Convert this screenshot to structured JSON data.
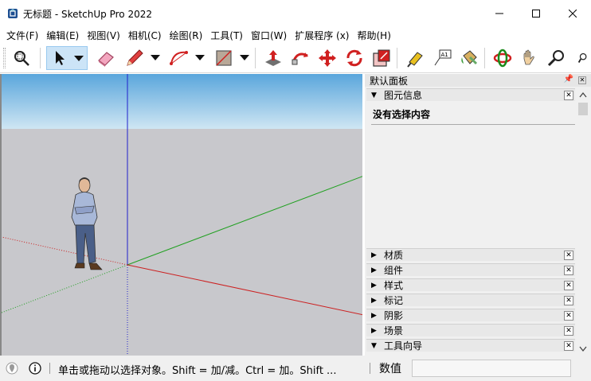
{
  "window": {
    "title": "无标题 - SketchUp Pro 2022",
    "app_icon": "sketchup-logo-icon",
    "controls": [
      "minimize-icon",
      "maximize-icon",
      "close-icon"
    ]
  },
  "menu": [
    {
      "label": "文件(F)"
    },
    {
      "label": "编辑(E)"
    },
    {
      "label": "视图(V)"
    },
    {
      "label": "相机(C)"
    },
    {
      "label": "绘图(R)"
    },
    {
      "label": "工具(T)"
    },
    {
      "label": "窗口(W)"
    },
    {
      "label": "扩展程序 (x)"
    },
    {
      "label": "帮助(H)"
    }
  ],
  "toolbar": {
    "tools": [
      "zoom-window-icon",
      "select-icon",
      "eraser-icon",
      "pencil-line-icon",
      "arc-icon",
      "rectangle-icon",
      "push-pull-icon",
      "follow-me-icon",
      "move-icon",
      "rotate-icon",
      "scale-icon",
      "tape-measure-icon",
      "text-label-icon",
      "paint-bucket-icon",
      "orbit-icon",
      "pan-icon",
      "zoom-icon",
      "zoom-extents-icon"
    ],
    "text_tool_glyph": "A1",
    "active_tool": "select-icon"
  },
  "tray": {
    "title": "默认面板",
    "entity_info": {
      "label": "图元信息",
      "body": "没有选择内容",
      "expanded": true
    },
    "panels": [
      {
        "label": "材质",
        "expanded": false
      },
      {
        "label": "组件",
        "expanded": false
      },
      {
        "label": "样式",
        "expanded": false
      },
      {
        "label": "标记",
        "expanded": false
      },
      {
        "label": "阴影",
        "expanded": false
      },
      {
        "label": "场景",
        "expanded": false
      },
      {
        "label": "工具向导",
        "expanded": true
      }
    ]
  },
  "status": {
    "hint": "单击或拖动以选择对象。Shift = 加/减。Ctrl = 加。Shift ...",
    "measurements_label": "数值",
    "measurements_value": ""
  },
  "colors": {
    "sky_top": "#5aa6dc",
    "sky_bottom": "#cfe6f3",
    "ground": "#c8c8cc",
    "axis_red": "#cc2020",
    "axis_green": "#20a020",
    "axis_blue": "#2020cc"
  }
}
